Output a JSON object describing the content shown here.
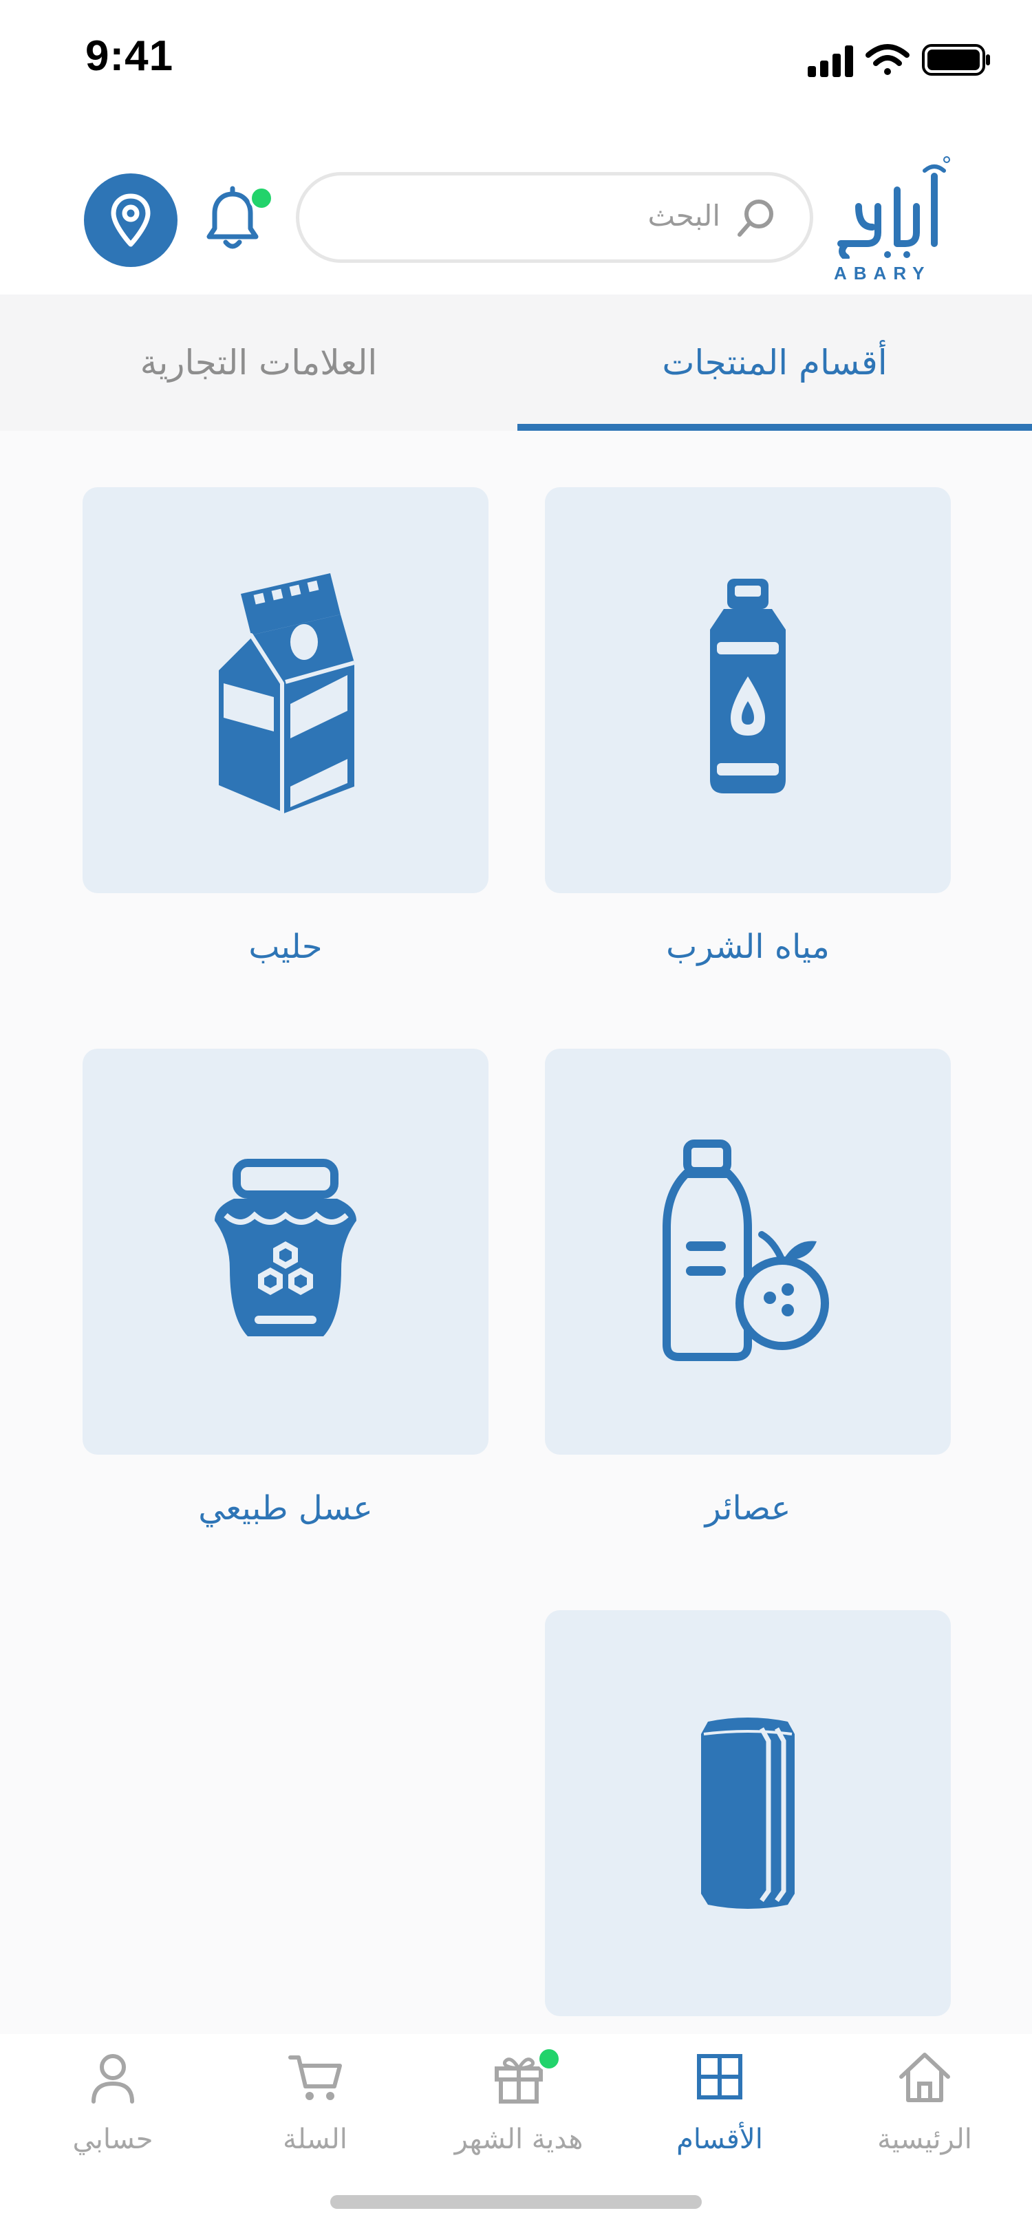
{
  "status_bar": {
    "time": "9:41"
  },
  "header": {
    "search_placeholder": "البحث",
    "logo_text": "ABARY",
    "logo_alt": "آباري"
  },
  "tabs": [
    {
      "label": "أقسام المنتجات",
      "active": true
    },
    {
      "label": "العلامات التجارية",
      "active": false
    }
  ],
  "categories": [
    {
      "label": "مياه الشرب",
      "icon": "water-bottle-icon"
    },
    {
      "label": "حليب",
      "icon": "milk-carton-icon"
    },
    {
      "label": "عصائر",
      "icon": "juice-icon"
    },
    {
      "label": "عسل طبيعي",
      "icon": "honey-jar-icon"
    },
    {
      "label": "",
      "icon": "soda-can-icon"
    }
  ],
  "bottom_nav": [
    {
      "label": "الرئيسية",
      "icon": "home-icon",
      "active": false
    },
    {
      "label": "الأقسام",
      "icon": "grid-icon",
      "active": true
    },
    {
      "label": "هدية الشهر",
      "icon": "gift-icon",
      "active": false,
      "badge": true
    },
    {
      "label": "السلة",
      "icon": "cart-icon",
      "active": false
    },
    {
      "label": "حسابي",
      "icon": "user-icon",
      "active": false
    }
  ],
  "colors": {
    "accent": "#2E75B6",
    "card_bg": "#E6EEF6",
    "badge": "#22D36B",
    "inactive": "#A6A6A6"
  }
}
